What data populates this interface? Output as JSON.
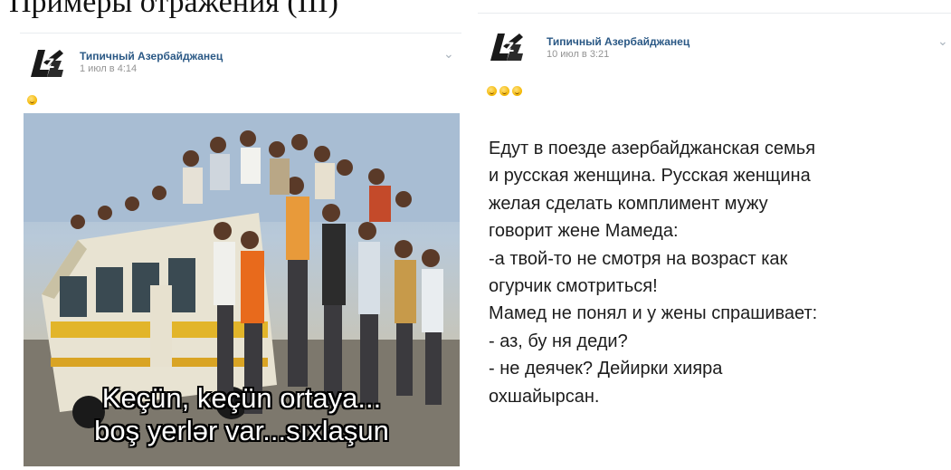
{
  "caption": {
    "text": "Примеры отражения (III)"
  },
  "posts": [
    {
      "author": "Типичный Азербайджанец",
      "time": "1 июл в 4:14",
      "emoji_count": 1,
      "meme_lines": [
        "Keçün, keçün ortaya...",
        "boş yerlər var...sıxlaşun"
      ]
    },
    {
      "author": "Типичный Азербайджанец",
      "time": "10 июл в 3:21",
      "emoji_count": 3,
      "text_lines": [
        "Едут в поезде азербайджанская семья",
        "и русская женщина. Русская женщина",
        "желая сделать комплимент мужу",
        "говорит жене Мамеда:",
        "-а твой-то не смотря на возраст как",
        "огурчик смотриться!",
        "Мамед не понял и у жены спрашивает:",
        "- аз, бу ня деди?",
        "- не деячек? Дейирки хияра",
        "охшайырсан."
      ]
    }
  ],
  "colors": {
    "author": "#2a5885",
    "time": "#939393",
    "divider": "#e9ecef"
  },
  "icons": {
    "avatar": "community-logo-icon",
    "menu": "chevron-down-icon",
    "emoji": "grinning-emoji-icon"
  }
}
